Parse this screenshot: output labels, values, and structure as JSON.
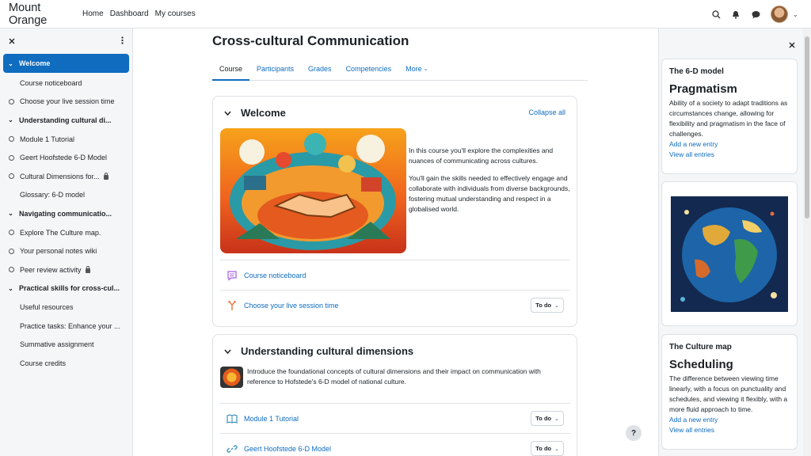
{
  "app": {
    "brand": "Mount Orange"
  },
  "topnav": {
    "items": [
      "Home",
      "Dashboard",
      "My courses"
    ]
  },
  "lnav": {
    "items": [
      {
        "label": "Welcome",
        "type": "section",
        "active": true
      },
      {
        "label": "Course noticeboard",
        "type": "plain"
      },
      {
        "label": "Choose your live session time",
        "type": "circle"
      },
      {
        "label": "Understanding cultural di...",
        "type": "section"
      },
      {
        "label": "Module 1 Tutorial",
        "type": "circle"
      },
      {
        "label": "Geert Hoofstede 6-D Model",
        "type": "circle"
      },
      {
        "label": "Cultural Dimensions for...",
        "type": "circle",
        "locked": true
      },
      {
        "label": "Glossary: 6-D model",
        "type": "plain"
      },
      {
        "label": "Navigating communicatio...",
        "type": "section"
      },
      {
        "label": "Explore The Culture map.",
        "type": "circle"
      },
      {
        "label": "Your personal notes wiki",
        "type": "circle"
      },
      {
        "label": "Peer review activity",
        "type": "circle",
        "locked": true
      },
      {
        "label": "Practical skills for cross-cul...",
        "type": "section"
      },
      {
        "label": "Useful resources",
        "type": "plain"
      },
      {
        "label": "Practice tasks: Enhance your ...",
        "type": "plain"
      },
      {
        "label": "Summative assignment",
        "type": "plain"
      },
      {
        "label": "Course credits",
        "type": "plain"
      }
    ]
  },
  "course": {
    "title": "Cross-cultural Communication",
    "tabs": [
      "Course",
      "Participants",
      "Grades",
      "Competencies",
      "More"
    ]
  },
  "welcome": {
    "title": "Welcome",
    "collapse_label": "Collapse all",
    "summary_p1": "In this course you'll explore the complexities and nuances of communicating across cultures.",
    "summary_p2": "You'll gain the skills needed to effectively engage and collaborate with individuals from diverse backgrounds, fostering mutual understanding and respect in a globalised world.",
    "activities": [
      {
        "label": "Course noticeboard"
      },
      {
        "label": "Choose your live session time",
        "todo": "To do"
      }
    ]
  },
  "section2": {
    "title": "Understanding cultural dimensions",
    "summary": "Introduce the foundational concepts of cultural dimensions and their impact on communication with reference to Hofstede's 6-D model of national culture.",
    "activities": [
      {
        "label": "Module 1 Tutorial",
        "todo": "To do"
      },
      {
        "label": "Geert Hoofstede 6-D Model",
        "todo": "To do"
      }
    ]
  },
  "blocks": {
    "b1": {
      "title": "The 6-D model",
      "term": "Pragmatism",
      "definition": "Ability of a society to adapt traditions as circumstances change, allowing for flexibility and pragmatism in the face of challenges.",
      "add": "Add a new entry",
      "view": "View all entries"
    },
    "b3": {
      "title": "The Culture map",
      "term": "Scheduling",
      "definition": "The difference between viewing time linearly, with a focus on punctuality and schedules, and viewing it flexibly, with a more fluid approach to time.",
      "add": "Add a new entry",
      "view": "View all entries"
    }
  },
  "help": "?",
  "colors": {
    "accent": "#0f6cbf",
    "drawer_bg": "#f5f6f8"
  }
}
